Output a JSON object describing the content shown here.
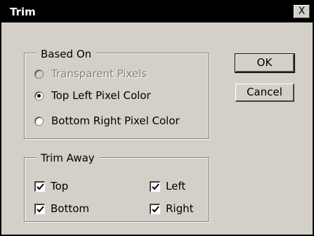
{
  "window": {
    "title": "Trim",
    "close_label": "X"
  },
  "based_on": {
    "legend": "Based On",
    "options": [
      {
        "label": "Transparent Pixels",
        "selected": false,
        "enabled": false
      },
      {
        "label": "Top Left Pixel Color",
        "selected": true,
        "enabled": true
      },
      {
        "label": "Bottom Right Pixel Color",
        "selected": false,
        "enabled": true
      }
    ]
  },
  "trim_away": {
    "legend": "Trim Away",
    "checks": [
      {
        "label": "Top",
        "checked": true
      },
      {
        "label": "Left",
        "checked": true
      },
      {
        "label": "Bottom",
        "checked": true
      },
      {
        "label": "Right",
        "checked": true
      }
    ]
  },
  "buttons": {
    "ok": "OK",
    "cancel": "Cancel"
  },
  "colors": {
    "face": "#d4d0c8",
    "title_bar": "#000000",
    "disabled_text": "#808080"
  }
}
